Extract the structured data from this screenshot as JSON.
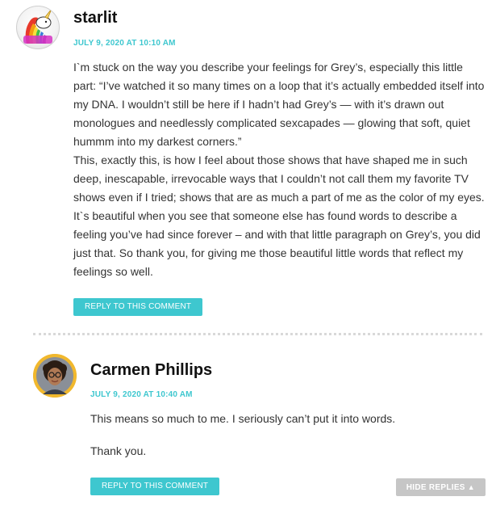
{
  "comments": [
    {
      "author": "starlit",
      "date": "JULY 9, 2020 AT 10:10 AM",
      "avatar_icon": "unicorn-rainbow-avatar",
      "paragraphs": [
        "I`m stuck on the way you describe your feelings for Grey’s, especially this little part: “I’ve watched it so many times on a loop that it’s actually embedded itself into my DNA. I wouldn’t still be here if I hadn’t had Grey’s — with it’s drawn out monologues and needlessly complicated sexcapades — glowing that soft, quiet hummm into my darkest corners.”",
        "This, exactly this, is how I feel about those shows that have shaped me in such deep, inescapable, irrevocable ways that I couldn’t not call them my favorite TV shows even if I tried; shows that are as much a part of me as the color of my eyes. It`s beautiful when you see that someone else has found words to describe a feeling you’ve had since forever – and with that little paragraph on Grey’s, you did just that. So thank you, for giving me those beautiful little words that reflect my feelings so well."
      ],
      "reply_label": "REPLY TO THIS COMMENT"
    },
    {
      "author": "Carmen Phillips",
      "date": "JULY 9, 2020 AT 10:40 AM",
      "avatar_icon": "user-photo-avatar",
      "paragraphs": [
        "This means so much to me. I seriously can’t put it into words.",
        "Thank you."
      ],
      "reply_label": "REPLY TO THIS COMMENT"
    }
  ],
  "hide_replies_label": "HIDE REPLIES",
  "hide_replies_icon": "▲",
  "colors": {
    "accent": "#3ec7cf",
    "muted_button": "#c6c6c6",
    "text": "#333333",
    "avatar_ring": "#f1b82d"
  }
}
